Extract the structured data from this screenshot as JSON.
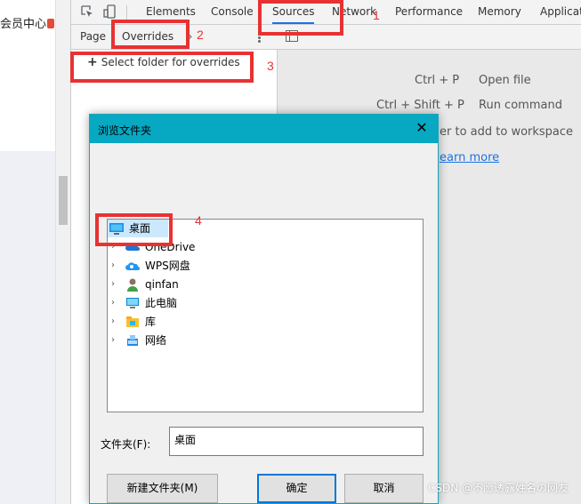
{
  "page": {
    "vip_text": "会员中心"
  },
  "devtools": {
    "tabs": [
      {
        "label": "Elements"
      },
      {
        "label": "Console"
      },
      {
        "label": "Sources"
      },
      {
        "label": "Network"
      },
      {
        "label": "Performance"
      },
      {
        "label": "Memory"
      },
      {
        "label": "Applicatio"
      }
    ],
    "subtabs": {
      "page": "Page",
      "overrides": "Overrides",
      "more": "»"
    },
    "navigator": {
      "select_folder": "Select folder for overrides"
    },
    "editor": {
      "shortcuts": [
        {
          "key": "Ctrl + P",
          "label": "Open file"
        },
        {
          "key": "Ctrl + Shift + P",
          "label": "Run command"
        }
      ],
      "workspace_hint": "er to add to workspace",
      "learn_more": "earn more"
    }
  },
  "annotations": {
    "n1": "1",
    "n2": "2",
    "n3": "3",
    "n4": "4"
  },
  "dialog": {
    "title": "浏览文件夹",
    "close": "✕",
    "tree": [
      {
        "label": "桌面",
        "icon": "desktop-icon",
        "selected": true
      },
      {
        "label": "OneDrive",
        "icon": "onedrive-icon"
      },
      {
        "label": "WPS网盘",
        "icon": "wps-cloud-icon"
      },
      {
        "label": "qinfan",
        "icon": "user-icon"
      },
      {
        "label": "此电脑",
        "icon": "computer-icon"
      },
      {
        "label": "库",
        "icon": "library-icon"
      },
      {
        "label": "网络",
        "icon": "network-icon"
      }
    ],
    "folder_label": "文件夹(F):",
    "folder_value": "桌面",
    "buttons": {
      "new_folder": "新建文件夹(M)",
      "ok": "确定",
      "cancel": "取消"
    }
  },
  "watermark": "CSDN @不愿透露姓名の网友",
  "colors": {
    "accent": "#1a73e8",
    "annotation_red": "#e83232",
    "dialog_title": "#07a8c2"
  }
}
